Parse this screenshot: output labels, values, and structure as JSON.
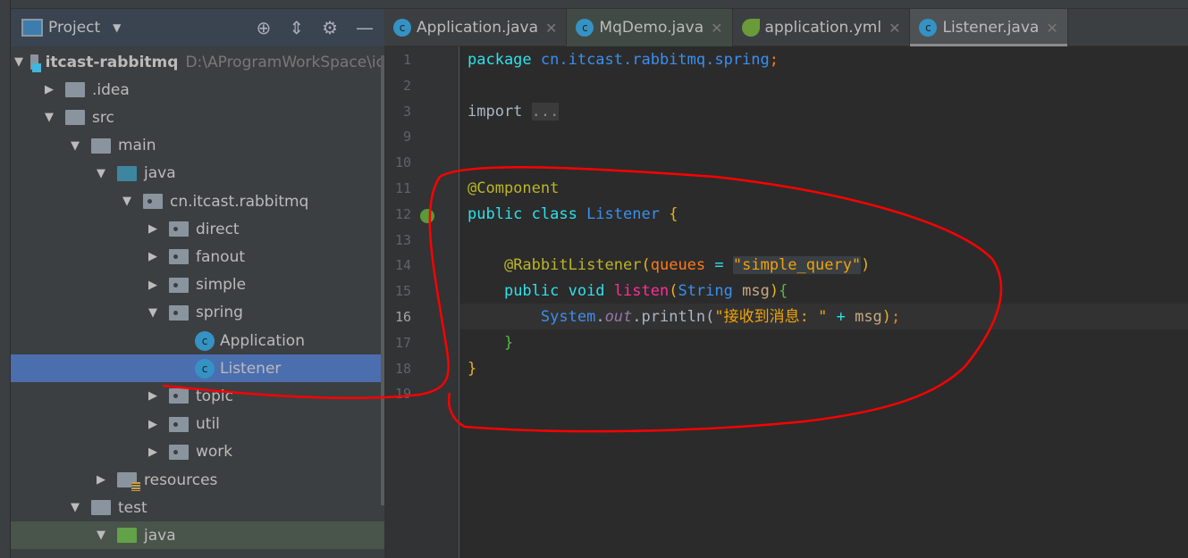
{
  "project_panel": {
    "title": "Project",
    "tools": [
      "locate-icon",
      "collapse-icon",
      "gear-icon",
      "minimize-icon"
    ],
    "tree": [
      {
        "label": "itcast-rabbitmq",
        "path": "D:\\AProgramWorkSpace\\ic",
        "depth": 0,
        "arrow": "down",
        "icon": "module",
        "bold": true
      },
      {
        "label": ".idea",
        "depth": 1,
        "arrow": "right",
        "icon": "folder"
      },
      {
        "label": "src",
        "depth": 1,
        "arrow": "down",
        "icon": "folder"
      },
      {
        "label": "main",
        "depth": 2,
        "arrow": "down",
        "icon": "folder"
      },
      {
        "label": "java",
        "depth": 3,
        "arrow": "down",
        "icon": "source-folder"
      },
      {
        "label": "cn.itcast.rabbitmq",
        "depth": 4,
        "arrow": "down",
        "icon": "package"
      },
      {
        "label": "direct",
        "depth": 5,
        "arrow": "right",
        "icon": "package"
      },
      {
        "label": "fanout",
        "depth": 5,
        "arrow": "right",
        "icon": "package"
      },
      {
        "label": "simple",
        "depth": 5,
        "arrow": "right",
        "icon": "package"
      },
      {
        "label": "spring",
        "depth": 5,
        "arrow": "down",
        "icon": "package"
      },
      {
        "label": "Application",
        "depth": 6,
        "arrow": "",
        "icon": "spring-boot-class"
      },
      {
        "label": "Listener",
        "depth": 6,
        "arrow": "",
        "icon": "class",
        "selected": true
      },
      {
        "label": "topic",
        "depth": 5,
        "arrow": "right",
        "icon": "package"
      },
      {
        "label": "util",
        "depth": 5,
        "arrow": "right",
        "icon": "package"
      },
      {
        "label": "work",
        "depth": 5,
        "arrow": "right",
        "icon": "package"
      },
      {
        "label": "resources",
        "depth": 3,
        "arrow": "right",
        "icon": "resources-folder"
      },
      {
        "label": "test",
        "depth": 2,
        "arrow": "down",
        "icon": "folder"
      },
      {
        "label": "java",
        "depth": 3,
        "arrow": "down",
        "icon": "test-folder",
        "highlight": true
      }
    ]
  },
  "tabs": [
    {
      "label": "Application.java",
      "icon": "spring-boot-class"
    },
    {
      "label": "MqDemo.java",
      "icon": "class"
    },
    {
      "label": "application.yml",
      "icon": "spring-config"
    },
    {
      "label": "Listener.java",
      "icon": "class",
      "active": true
    }
  ],
  "editor": {
    "current_line": "16",
    "lines": [
      {
        "n": "1",
        "t": [
          [
            "kw",
            "package "
          ],
          [
            "pk",
            "cn.itcast.rabbitmq.spring"
          ],
          [
            "pr",
            ";"
          ]
        ]
      },
      {
        "n": "2",
        "t": []
      },
      {
        "n": "3",
        "t": [
          [
            "",
            "import "
          ],
          [
            "fd",
            "..."
          ]
        ]
      },
      {
        "n": "9",
        "t": []
      },
      {
        "n": "10",
        "t": []
      },
      {
        "n": "11",
        "t": [
          [
            "an",
            "@Component"
          ]
        ]
      },
      {
        "n": "12",
        "t": [
          [
            "kw",
            "public class "
          ],
          [
            "ty",
            "Listener "
          ],
          [
            "br",
            "{"
          ]
        ]
      },
      {
        "n": "13",
        "t": []
      },
      {
        "n": "14",
        "t": [
          [
            "",
            "    "
          ],
          [
            "an",
            "@RabbitListener"
          ],
          [
            "br",
            "("
          ],
          [
            "pr",
            "queues "
          ],
          [
            "kw",
            "= "
          ],
          [
            "st hl",
            "\"simple_query\""
          ],
          [
            "br",
            ")"
          ]
        ]
      },
      {
        "n": "15",
        "t": [
          [
            "",
            "    "
          ],
          [
            "kw",
            "public void "
          ],
          [
            "mt",
            "listen"
          ],
          [
            "br",
            "("
          ],
          [
            "ty",
            "String "
          ],
          [
            "va",
            "msg"
          ],
          [
            "br",
            ")"
          ],
          [
            "gb",
            "{"
          ]
        ]
      },
      {
        "n": "16",
        "t": [
          [
            "",
            "        "
          ],
          [
            "ty",
            "System"
          ],
          [
            "",
            "."
          ],
          [
            "it",
            "out"
          ],
          [
            "",
            ".println("
          ],
          [
            "st",
            "\"接收到消息: \" "
          ],
          [
            "kw",
            "+ "
          ],
          [
            "va",
            "msg"
          ],
          [
            "br",
            ")"
          ],
          [
            "pr",
            ";"
          ]
        ]
      },
      {
        "n": "17",
        "t": [
          [
            "",
            "    "
          ],
          [
            "gb",
            "}"
          ]
        ]
      },
      {
        "n": "18",
        "t": [
          [
            "br",
            "}"
          ]
        ]
      },
      {
        "n": "19",
        "t": []
      }
    ]
  },
  "annotation_color": "#ff0000"
}
